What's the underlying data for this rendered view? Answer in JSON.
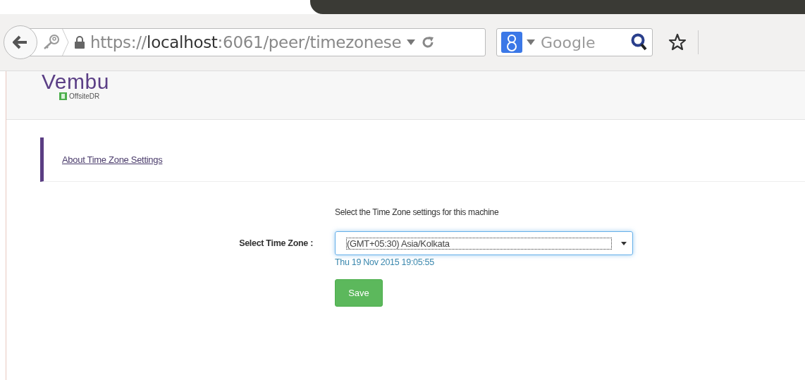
{
  "browser": {
    "url": "https://**localhost**:6061/peer/timezonese",
    "search_placeholder": "Google"
  },
  "header": {
    "logo": "Vembu",
    "product": "OffsiteDR"
  },
  "info": {
    "link": "About Time Zone Settings"
  },
  "form": {
    "instruction": "Select the Time Zone settings for this machine",
    "label": "Select Time Zone :",
    "value": "(GMT+05:30) Asia/Kolkata",
    "focused": true,
    "time": "Thu 19 Nov 2015 19:05:55",
    "button": "Save"
  }
}
